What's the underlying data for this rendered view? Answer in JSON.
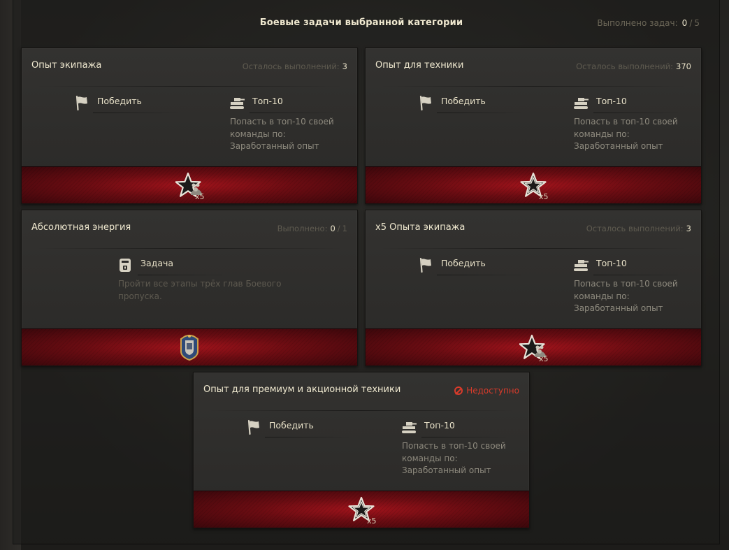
{
  "header": {
    "title": "Боевые задачи выбранной категории",
    "progress_label": "Выполнено задач:",
    "progress_done": "0",
    "progress_sep": "/",
    "progress_total": "5"
  },
  "cards": [
    {
      "title": "Опыт экипажа",
      "status_label": "Осталось выполнений:",
      "status_value": "3",
      "conditions": [
        {
          "label": "Победить",
          "icon": "flag-icon"
        },
        {
          "label": "Топ-10",
          "icon": "tank-icon",
          "desc_lines": [
            "Попасть в топ-10 своей",
            "команды по:",
            "Заработанный опыт"
          ]
        }
      ],
      "reward": {
        "icon": "crew-star-icon",
        "multiplier": "x5"
      }
    },
    {
      "title": "Опыт для техники",
      "status_label": "Осталось выполнений:",
      "status_value": "370",
      "conditions": [
        {
          "label": "Победить",
          "icon": "flag-icon"
        },
        {
          "label": "Топ-10",
          "icon": "tank-icon",
          "desc_lines": [
            "Попасть в топ-10 своей",
            "команды по:",
            "Заработанный опыт"
          ]
        }
      ],
      "reward": {
        "icon": "star-icon",
        "multiplier": "x5"
      }
    },
    {
      "title": "Абсолютная энергия",
      "status_label": "Выполнено:",
      "status_value": "0",
      "status_sep": "/",
      "status_total": "1",
      "conditions": [
        {
          "label": "Задача",
          "icon": "task-icon",
          "desc_lines": [
            "Пройти все этапы трёх глав Боевого",
            "пропуска."
          ]
        }
      ],
      "reward": {
        "icon": "badge-icon",
        "multiplier": ""
      }
    },
    {
      "title": "x5 Опыта экипажа",
      "status_label": "Осталось выполнений:",
      "status_value": "3",
      "conditions": [
        {
          "label": "Победить",
          "icon": "flag-icon"
        },
        {
          "label": "Топ-10",
          "icon": "tank-icon",
          "desc_lines": [
            "Попасть в топ-10 своей",
            "команды по:",
            "Заработанный опыт"
          ]
        }
      ],
      "reward": {
        "icon": "crew-star-icon",
        "multiplier": "x5"
      }
    },
    {
      "title": "Опыт для премиум и акционной техники",
      "unavailable_label": "Недоступно",
      "conditions": [
        {
          "label": "Победить",
          "icon": "flag-icon"
        },
        {
          "label": "Топ-10",
          "icon": "tank-icon",
          "desc_lines": [
            "Попасть в топ-10 своей",
            "команды по:",
            "Заработанный опыт"
          ]
        }
      ],
      "reward": {
        "icon": "star-icon",
        "multiplier": "x5"
      }
    }
  ],
  "colors": {
    "accent_red": "#d93b2b",
    "reward_red": "#a0131b",
    "text_light": "#efe8cf",
    "text_dim": "#5f5b50"
  }
}
